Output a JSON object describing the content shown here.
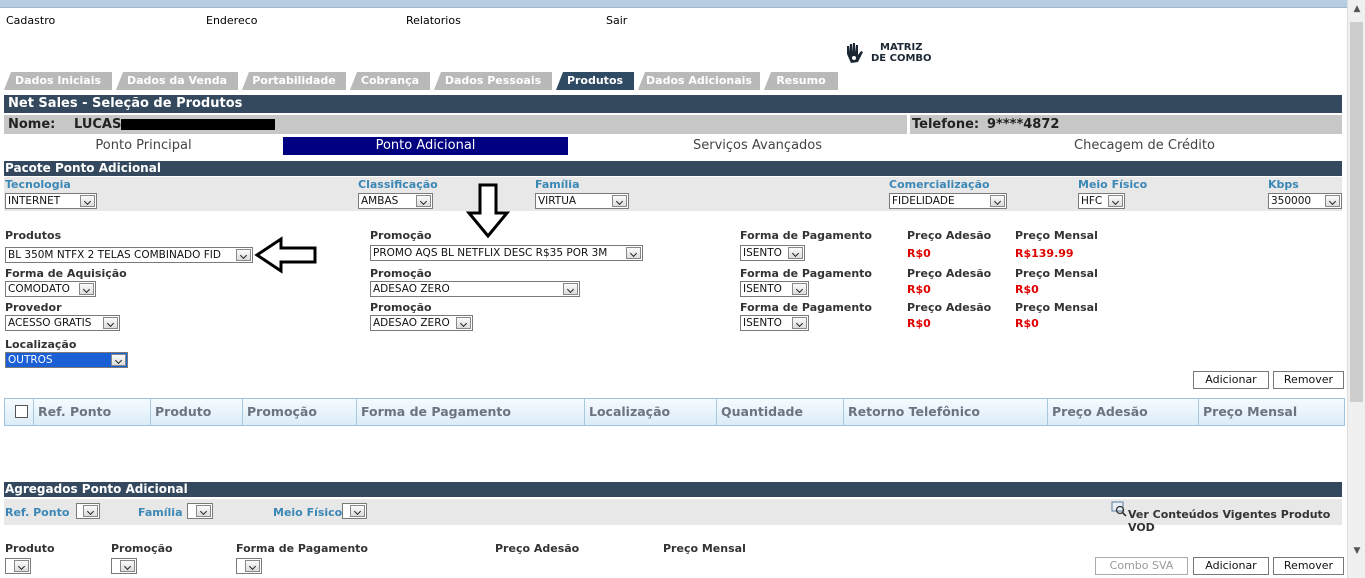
{
  "menu": {
    "cadastro": "Cadastro",
    "endereco": "Endereco",
    "relatorios": "Relatorios",
    "sair": "Sair"
  },
  "logo": {
    "line1": "MATRIZ",
    "line2": "DE COMBO"
  },
  "tabs": [
    "Dados Iniciais",
    "Dados da Venda",
    "Portabilidade",
    "Cobrança",
    "Dados Pessoais",
    "Produtos",
    "Dados Adicionais",
    "Resumo"
  ],
  "active_tab": "Produtos",
  "page_title": "Net Sales - Seleção de Produtos",
  "customer": {
    "name_label": "Nome:",
    "name_value": "LUCAS",
    "phone_label": "Telefone:",
    "phone_value": "9****4872"
  },
  "subtabs": [
    "Ponto Principal",
    "Ponto Adicional",
    "Serviços Avançados",
    "Checagem de Crédito"
  ],
  "active_subtab": "Ponto Adicional",
  "section_title": "Pacote Ponto Adicional",
  "filters": {
    "tecnologia": {
      "label": "Tecnologia",
      "value": "INTERNET"
    },
    "classificacao": {
      "label": "Classificação",
      "value": "AMBAS"
    },
    "familia": {
      "label": "Família",
      "value": "VIRTUA"
    },
    "comercializacao": {
      "label": "Comercialização",
      "value": "FIDELIDADE"
    },
    "meio_fisico": {
      "label": "Meio Físico",
      "value": "HFC"
    },
    "kbps": {
      "label": "Kbps",
      "value": "350000"
    }
  },
  "form": {
    "produtos": {
      "label": "Produtos",
      "value": "BL 350M NTFX 2 TELAS COMBINADO FID"
    },
    "promocao1": {
      "label": "Promoção",
      "value": "PROMO AQS BL NETFLIX DESC R$35 POR 3M"
    },
    "forma_aquisicao": {
      "label": "Forma de Aquisição",
      "value": "COMODATO"
    },
    "promocao2": {
      "label": "Promoção",
      "value": "ADESAO ZERO"
    },
    "provedor": {
      "label": "Provedor",
      "value": "ACESSO GRATIS"
    },
    "promocao3": {
      "label": "Promoção",
      "value": "ADESAO ZERO"
    },
    "localizacao": {
      "label": "Localização",
      "value": "OUTROS"
    },
    "pagamento_label": "Forma de Pagamento",
    "pagamento_value": "ISENTO",
    "adesao_label": "Preço Adesão",
    "mensal_label": "Preço Mensal",
    "rows": [
      {
        "adesao": "R$0",
        "mensal": "R$139.99"
      },
      {
        "adesao": "R$0",
        "mensal": "R$0"
      },
      {
        "adesao": "R$0",
        "mensal": "R$0"
      }
    ]
  },
  "buttons": {
    "adicionar": "Adicionar",
    "remover": "Remover",
    "combo_sva": "Combo SVA"
  },
  "grid_columns": [
    "Ref. Ponto",
    "Produto",
    "Promoção",
    "Forma de Pagamento",
    "Localização",
    "Quantidade",
    "Retorno Telefônico",
    "Preço Adesão",
    "Preço Mensal"
  ],
  "agregados": {
    "title": "Agregados Ponto Adicional",
    "ref_ponto": "Ref. Ponto",
    "familia": "Família",
    "meio_fisico": "Meio Físico",
    "vod_link": "Ver Conteúdos Vigentes Produto VOD",
    "produto": "Produto",
    "promocao": "Promoção",
    "forma_pagamento": "Forma de Pagamento",
    "preco_adesao": "Preço Adesão",
    "preco_mensal": "Preço Mensal"
  }
}
